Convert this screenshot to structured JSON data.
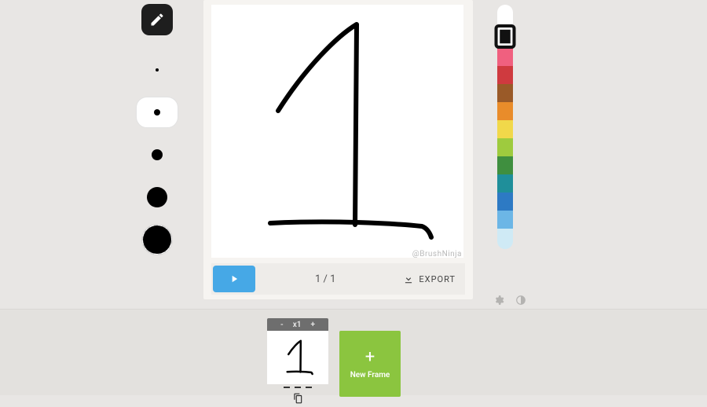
{
  "tools": {
    "active": "pencil"
  },
  "brush_sizes": {
    "selected_index": 1
  },
  "canvas": {
    "watermark": "@BrushNinja",
    "frame_counter": "1 / 1",
    "export_label": "EXPORT"
  },
  "palette": {
    "colors": [
      "#ffffff",
      "#111111",
      "#f0607f",
      "#cf3a3f",
      "#9a5a28",
      "#e98c2a",
      "#f1d84a",
      "#9ecb3e",
      "#3f8f3f",
      "#1f8f9a",
      "#2d7ac4",
      "#6cb6e6",
      "#cfeaf5"
    ],
    "selected_index": 1
  },
  "timeline": {
    "zoom_minus": "-",
    "zoom_label": "x1",
    "zoom_plus": "+",
    "new_frame_plus": "+",
    "new_frame_label": "New Frame"
  }
}
